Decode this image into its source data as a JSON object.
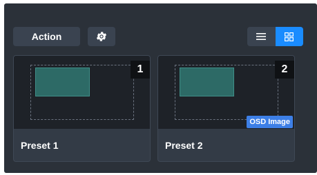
{
  "toolbar": {
    "action_label": "Action",
    "settings_icon": "gear-icon",
    "view_list_icon": "list-icon",
    "view_grid_icon": "grid-icon",
    "active_view": "grid",
    "accent_color": "#1a8cff"
  },
  "presets": [
    {
      "label": "Preset 1",
      "number": "1",
      "osd_badge": ""
    },
    {
      "label": "Preset 2",
      "number": "2",
      "osd_badge": "OSD Image"
    }
  ]
}
